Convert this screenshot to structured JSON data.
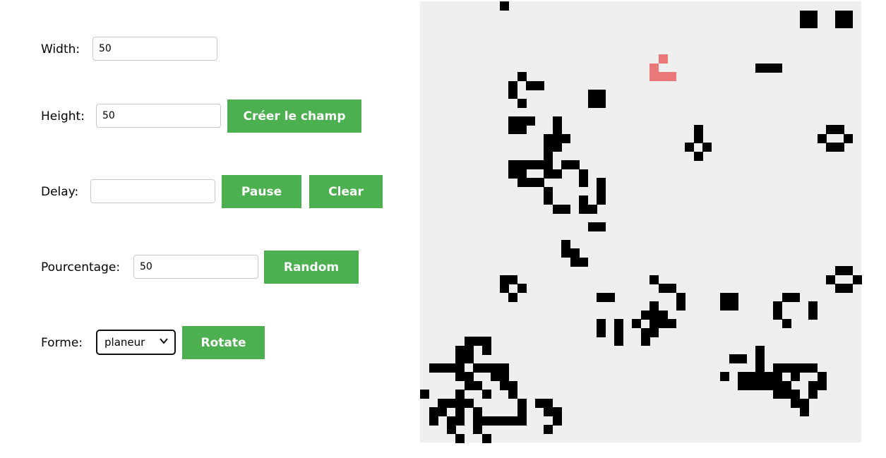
{
  "controls": {
    "width": {
      "label": "Width:",
      "value": "50"
    },
    "height": {
      "label": "Height:",
      "value": "50",
      "button": "Créer le champ"
    },
    "delay": {
      "label": "Delay:",
      "value": "",
      "pause_button": "Pause",
      "clear_button": "Clear"
    },
    "percentage": {
      "label": "Pourcentage:",
      "value": "50",
      "button": "Random"
    },
    "shape": {
      "label": "Forme:",
      "selected": "planeur",
      "button": "Rotate"
    }
  },
  "grid": {
    "columns": 50,
    "rows": 50,
    "colors": {
      "background": "#efefef",
      "alive": "#000000",
      "preview": "#eb7878"
    },
    "preview_cells": [
      [
        27,
        6
      ],
      [
        26,
        7
      ],
      [
        26,
        8
      ],
      [
        27,
        8
      ],
      [
        28,
        8
      ]
    ],
    "alive_cells": [
      [
        9,
        0
      ],
      [
        43,
        1
      ],
      [
        44,
        1
      ],
      [
        47,
        1
      ],
      [
        48,
        1
      ],
      [
        43,
        2
      ],
      [
        44,
        2
      ],
      [
        47,
        2
      ],
      [
        48,
        2
      ],
      [
        38,
        7
      ],
      [
        39,
        7
      ],
      [
        40,
        7
      ],
      [
        11,
        8
      ],
      [
        10,
        9
      ],
      [
        12,
        9
      ],
      [
        13,
        9
      ],
      [
        10,
        10
      ],
      [
        11,
        11
      ],
      [
        19,
        10
      ],
      [
        20,
        10
      ],
      [
        19,
        11
      ],
      [
        20,
        11
      ],
      [
        10,
        13
      ],
      [
        11,
        13
      ],
      [
        12,
        13
      ],
      [
        15,
        13
      ],
      [
        10,
        14
      ],
      [
        11,
        14
      ],
      [
        15,
        14
      ],
      [
        15,
        15
      ],
      [
        14,
        15
      ],
      [
        16,
        15
      ],
      [
        14,
        16
      ],
      [
        15,
        16
      ],
      [
        14,
        17
      ],
      [
        10,
        18
      ],
      [
        11,
        18
      ],
      [
        12,
        18
      ],
      [
        13,
        18
      ],
      [
        14,
        18
      ],
      [
        16,
        18
      ],
      [
        17,
        18
      ],
      [
        10,
        19
      ],
      [
        11,
        19
      ],
      [
        14,
        19
      ],
      [
        15,
        19
      ],
      [
        18,
        19
      ],
      [
        11,
        20
      ],
      [
        12,
        20
      ],
      [
        13,
        20
      ],
      [
        18,
        20
      ],
      [
        20,
        20
      ],
      [
        14,
        21
      ],
      [
        20,
        21
      ],
      [
        14,
        22
      ],
      [
        18,
        22
      ],
      [
        20,
        22
      ],
      [
        15,
        23
      ],
      [
        16,
        23
      ],
      [
        18,
        23
      ],
      [
        19,
        23
      ],
      [
        19,
        25
      ],
      [
        20,
        25
      ],
      [
        16,
        27
      ],
      [
        16,
        28
      ],
      [
        17,
        28
      ],
      [
        17,
        29
      ],
      [
        18,
        29
      ],
      [
        31,
        14
      ],
      [
        31,
        15
      ],
      [
        30,
        16
      ],
      [
        32,
        16
      ],
      [
        31,
        17
      ],
      [
        46,
        14
      ],
      [
        47,
        14
      ],
      [
        45,
        15
      ],
      [
        48,
        15
      ],
      [
        46,
        16
      ],
      [
        47,
        16
      ],
      [
        47,
        30
      ],
      [
        48,
        30
      ],
      [
        46,
        31
      ],
      [
        49,
        31
      ],
      [
        47,
        32
      ],
      [
        48,
        32
      ],
      [
        9,
        31
      ],
      [
        10,
        31
      ],
      [
        9,
        32
      ],
      [
        11,
        32
      ],
      [
        10,
        33
      ],
      [
        26,
        31
      ],
      [
        27,
        32
      ],
      [
        28,
        32
      ],
      [
        29,
        33
      ],
      [
        29,
        34
      ],
      [
        20,
        33
      ],
      [
        21,
        33
      ],
      [
        20,
        36
      ],
      [
        20,
        37
      ],
      [
        22,
        36
      ],
      [
        22,
        37
      ],
      [
        22,
        38
      ],
      [
        34,
        33
      ],
      [
        35,
        33
      ],
      [
        34,
        34
      ],
      [
        35,
        34
      ],
      [
        41,
        33
      ],
      [
        42,
        33
      ],
      [
        40,
        34
      ],
      [
        40,
        35
      ],
      [
        44,
        34
      ],
      [
        44,
        35
      ],
      [
        41,
        36
      ],
      [
        26,
        34
      ],
      [
        25,
        35
      ],
      [
        26,
        35
      ],
      [
        27,
        35
      ],
      [
        24,
        36
      ],
      [
        26,
        36
      ],
      [
        27,
        36
      ],
      [
        28,
        36
      ],
      [
        25,
        37
      ],
      [
        26,
        37
      ],
      [
        25,
        38
      ],
      [
        5,
        38
      ],
      [
        6,
        38
      ],
      [
        7,
        38
      ],
      [
        4,
        39
      ],
      [
        5,
        39
      ],
      [
        7,
        39
      ],
      [
        4,
        40
      ],
      [
        5,
        40
      ],
      [
        1,
        41
      ],
      [
        2,
        41
      ],
      [
        3,
        41
      ],
      [
        4,
        41
      ],
      [
        6,
        41
      ],
      [
        7,
        41
      ],
      [
        8,
        41
      ],
      [
        9,
        41
      ],
      [
        4,
        42
      ],
      [
        5,
        42
      ],
      [
        8,
        42
      ],
      [
        9,
        42
      ],
      [
        5,
        43
      ],
      [
        6,
        43
      ],
      [
        9,
        43
      ],
      [
        10,
        43
      ],
      [
        0,
        44
      ],
      [
        4,
        44
      ],
      [
        7,
        44
      ],
      [
        10,
        44
      ],
      [
        2,
        45
      ],
      [
        3,
        45
      ],
      [
        4,
        45
      ],
      [
        5,
        45
      ],
      [
        11,
        45
      ],
      [
        13,
        45
      ],
      [
        14,
        45
      ],
      [
        1,
        46
      ],
      [
        2,
        46
      ],
      [
        4,
        46
      ],
      [
        6,
        46
      ],
      [
        11,
        46
      ],
      [
        14,
        46
      ],
      [
        15,
        46
      ],
      [
        1,
        47
      ],
      [
        3,
        47
      ],
      [
        4,
        47
      ],
      [
        6,
        47
      ],
      [
        7,
        47
      ],
      [
        8,
        47
      ],
      [
        9,
        47
      ],
      [
        10,
        47
      ],
      [
        11,
        47
      ],
      [
        15,
        47
      ],
      [
        3,
        48
      ],
      [
        6,
        48
      ],
      [
        14,
        48
      ],
      [
        4,
        49
      ],
      [
        7,
        49
      ],
      [
        38,
        39
      ],
      [
        35,
        40
      ],
      [
        36,
        40
      ],
      [
        38,
        40
      ],
      [
        38,
        41
      ],
      [
        40,
        41
      ],
      [
        41,
        41
      ],
      [
        42,
        41
      ],
      [
        43,
        41
      ],
      [
        44,
        41
      ],
      [
        34,
        42
      ],
      [
        36,
        42
      ],
      [
        37,
        42
      ],
      [
        38,
        42
      ],
      [
        39,
        42
      ],
      [
        40,
        42
      ],
      [
        42,
        42
      ],
      [
        45,
        42
      ],
      [
        36,
        43
      ],
      [
        37,
        43
      ],
      [
        38,
        43
      ],
      [
        39,
        43
      ],
      [
        40,
        43
      ],
      [
        41,
        43
      ],
      [
        44,
        43
      ],
      [
        45,
        43
      ],
      [
        40,
        44
      ],
      [
        41,
        44
      ],
      [
        42,
        44
      ],
      [
        44,
        44
      ],
      [
        42,
        45
      ],
      [
        43,
        45
      ],
      [
        43,
        46
      ]
    ]
  }
}
